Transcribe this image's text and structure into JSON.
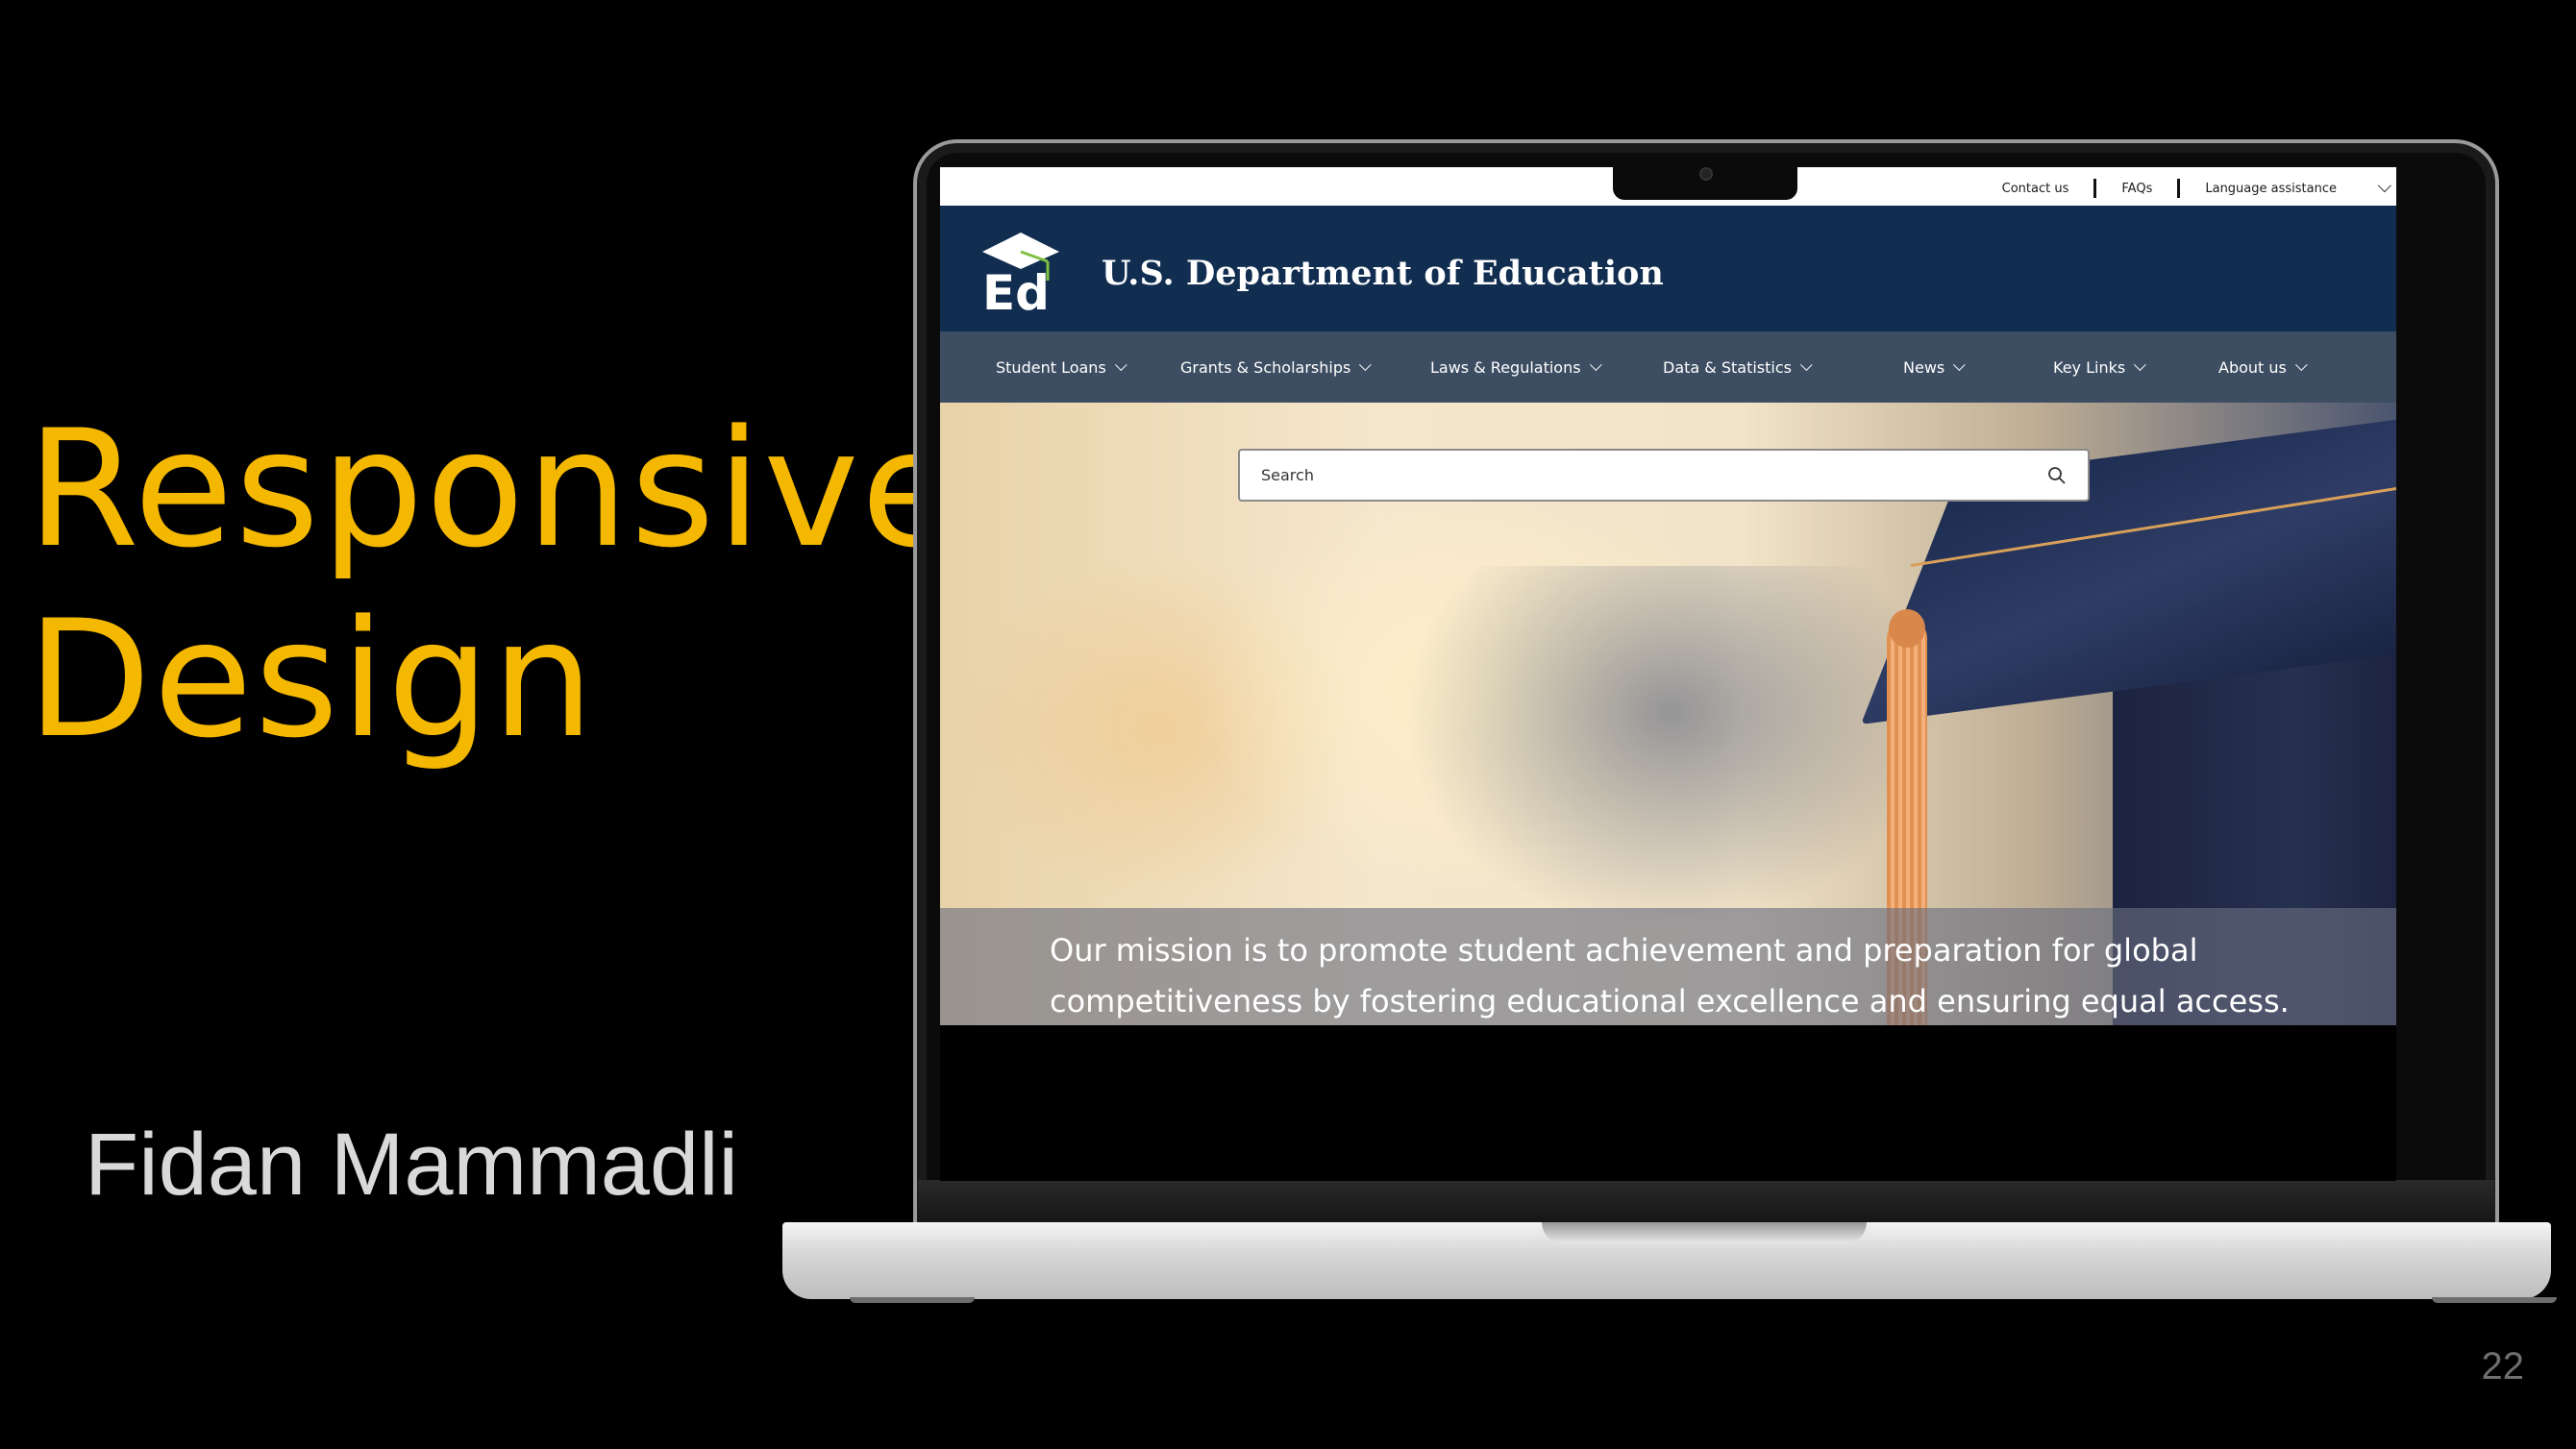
{
  "slide": {
    "title_line1": "Responsive",
    "title_line2": "Design",
    "author": "Fidan Mammadli",
    "page_number": "22"
  },
  "website": {
    "utility_links": [
      "Contact us",
      "FAQs",
      "Language assistance"
    ],
    "agency_name": "U.S. Department of Education",
    "logo_text": "Ed",
    "nav": [
      "Student Loans",
      "Grants & Scholarships",
      "Laws & Regulations",
      "Data & Statistics",
      "News",
      "Key Links",
      "About us"
    ],
    "search": {
      "placeholder": "Search"
    },
    "mission": "Our mission is to promote student achievement and preparation for global competitiveness by fostering educational excellence and ensuring equal access."
  },
  "colors": {
    "title_accent": "#f5b800",
    "brand_navy": "#112e51",
    "nav_slate": "#3d4e63"
  },
  "icons": [
    "graduation-cap-logo-icon",
    "search-icon",
    "chevron-down-icon",
    "camera-icon"
  ]
}
